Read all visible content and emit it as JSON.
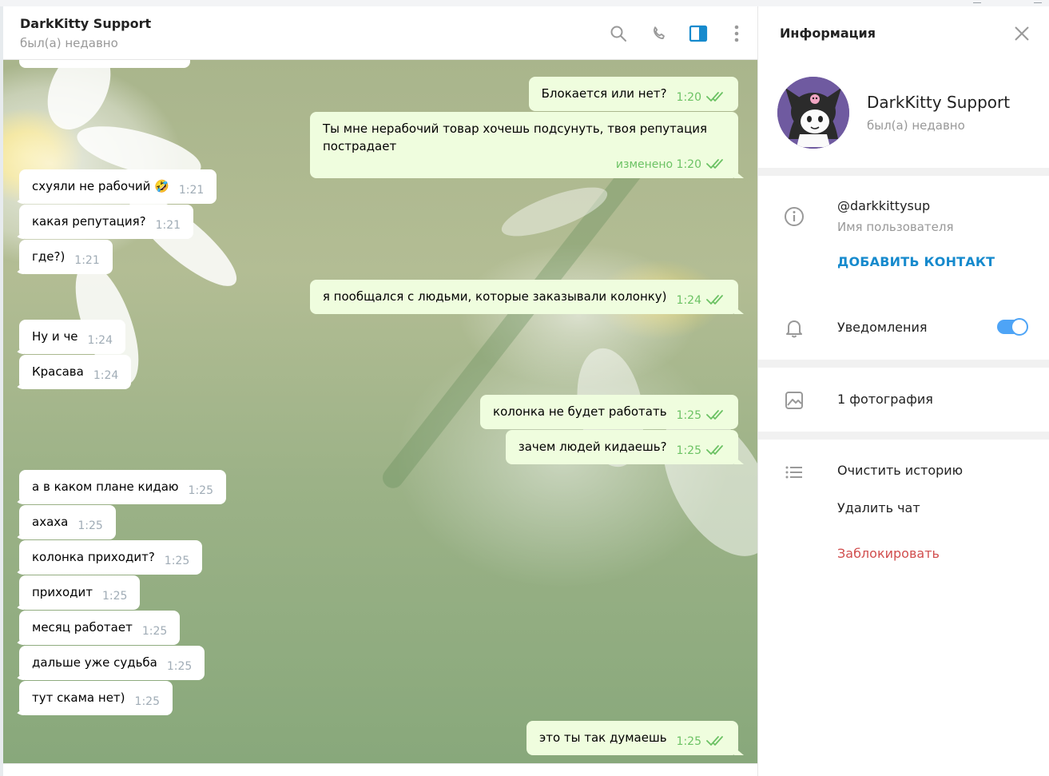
{
  "chat": {
    "title": "DarkKitty Support",
    "status": "был(а) недавно",
    "messages": [
      {
        "dir": "out",
        "text": "Блокается или нет?",
        "time": "1:20"
      },
      {
        "dir": "out",
        "text": "Ты мне нерабочий товар хочешь подсунуть, твоя репутация пострадает",
        "time": "изменено 1:20"
      },
      {
        "dir": "in",
        "text": "схуяли не рабочий 🤣",
        "time": "1:21"
      },
      {
        "dir": "in",
        "text": "какая репутация?",
        "time": "1:21"
      },
      {
        "dir": "in",
        "text": "где?)",
        "time": "1:21"
      },
      {
        "dir": "out",
        "text": "я пообщался с людьми, которые заказывали колонку)",
        "time": "1:24"
      },
      {
        "dir": "in",
        "text": "Ну и че",
        "time": "1:24"
      },
      {
        "dir": "in",
        "text": "Красава",
        "time": "1:24"
      },
      {
        "dir": "out",
        "text": "колонка не будет работать",
        "time": "1:25"
      },
      {
        "dir": "out",
        "text": "зачем людей кидаешь?",
        "time": "1:25"
      },
      {
        "dir": "in",
        "text": "а в каком плане кидаю",
        "time": "1:25"
      },
      {
        "dir": "in",
        "text": "ахаха",
        "time": "1:25"
      },
      {
        "dir": "in",
        "text": "колонка приходит?",
        "time": "1:25"
      },
      {
        "dir": "in",
        "text": "приходит",
        "time": "1:25"
      },
      {
        "dir": "in",
        "text": "месяц работает",
        "time": "1:25"
      },
      {
        "dir": "in",
        "text": "дальше уже судьба",
        "time": "1:25"
      },
      {
        "dir": "in",
        "text": "тут скама нет)",
        "time": "1:25"
      },
      {
        "dir": "out",
        "text": "это ты так думаешь",
        "time": "1:25"
      }
    ]
  },
  "info": {
    "title": "Информация",
    "name": "DarkKitty Support",
    "status": "был(а) недавно",
    "username": "@darkkittysup",
    "username_label": "Имя пользователя",
    "add_contact": "ДОБАВИТЬ КОНТАКТ",
    "notifications": "Уведомления",
    "notifications_on": true,
    "photos": "1 фотография",
    "clear_history": "Очистить историю",
    "delete_chat": "Удалить чат",
    "block": "Заблокировать"
  },
  "colors": {
    "accent": "#168acd",
    "toggle": "#4ea4f6",
    "outgoing_bubble": "#effdde",
    "read_check": "#6cc264",
    "danger": "#d14e4e"
  }
}
